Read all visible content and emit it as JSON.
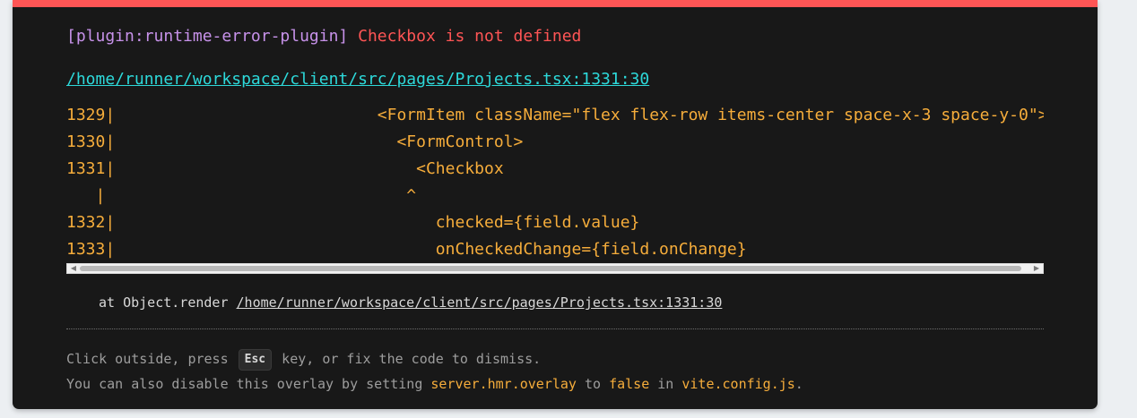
{
  "error": {
    "plugin": "[plugin:runtime-error-plugin]",
    "message": "Checkbox is not defined",
    "file": "/home/runner/workspace/client/src/pages/Projects.tsx:1331:30"
  },
  "code_frame": [
    {
      "text": "1329|                           <FormItem className=\"flex flex-row items-center space-x-3 space-y-0\">"
    },
    {
      "text": "1330|                             <FormControl>"
    },
    {
      "text": "1331|                               <Checkbox"
    },
    {
      "text": "   |                               ^"
    },
    {
      "text": "1332|                                 checked={field.value}"
    },
    {
      "text": "1333|                                 onCheckedChange={field.onChange}"
    }
  ],
  "stack": {
    "prefix": "at Object.render",
    "location": "/home/runner/workspace/client/src/pages/Projects.tsx:1331:30"
  },
  "tips": {
    "line1_part1": "Click outside, press",
    "key": "Esc",
    "line1_part2": "key, or fix the code to dismiss.",
    "line2_part1": "You can also disable this overlay by setting",
    "setting": "server.hmr.overlay",
    "line2_part2": "to",
    "value": "false",
    "line2_part3": "in",
    "config": "vite.config.js",
    "line2_part4": "."
  },
  "colors": {
    "border": "#ff5555",
    "plugin": "#c792ea",
    "message": "#ff5555",
    "link": "#2dd9da",
    "code": "#f6ad3b",
    "background": "#181818"
  }
}
